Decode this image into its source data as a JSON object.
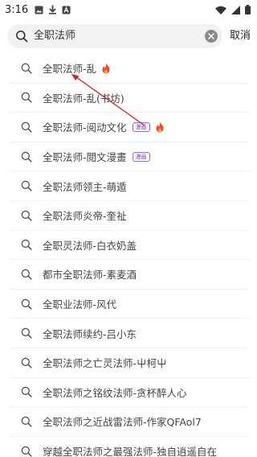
{
  "status_bar": {
    "time": "3:16",
    "icons_left": [
      "image-icon",
      "download-icon",
      "a-letter-icon"
    ],
    "icons_right": [
      "wifi-icon",
      "signal-icon",
      "battery-icon"
    ],
    "battery_text": "1"
  },
  "search": {
    "query": "全职法师",
    "cancel_label": "取消"
  },
  "suggestions": [
    {
      "text": "全职法师-乱",
      "hot": true,
      "badge": ""
    },
    {
      "text": "全职法师-乱(书坊)",
      "hot": false,
      "badge": ""
    },
    {
      "text": "全职法师-阅动文化",
      "hot": true,
      "badge": "漫画"
    },
    {
      "text": "全职法师-閲文漫畫",
      "hot": false,
      "badge": "漫画"
    },
    {
      "text": "全职法师领主-萌遁",
      "hot": false,
      "badge": ""
    },
    {
      "text": "全职法师炎帝-奎祉",
      "hot": false,
      "badge": ""
    },
    {
      "text": "全职灵法师-白衣奶盖",
      "hot": false,
      "badge": ""
    },
    {
      "text": "都市全职法师-素麦酒",
      "hot": false,
      "badge": ""
    },
    {
      "text": "全职业法师-风代",
      "hot": false,
      "badge": ""
    },
    {
      "text": "全职法师续约-吕小东",
      "hot": false,
      "badge": ""
    },
    {
      "text": "全职法师之亡灵法师-屮柯屮",
      "hot": false,
      "badge": ""
    },
    {
      "text": "全职法师之铭纹法师-贪杯醉人心",
      "hot": false,
      "badge": ""
    },
    {
      "text": "全职法师之近战雷法师-作家QFAol7",
      "hot": false,
      "badge": ""
    },
    {
      "text": "穿越全职法师之最强法师-独自逍遥自在",
      "hot": false,
      "badge": ""
    }
  ],
  "colors": {
    "annotation_arrow": "#d81f26",
    "badge": "#7b3fd0",
    "fire": "#ee4d2d"
  }
}
